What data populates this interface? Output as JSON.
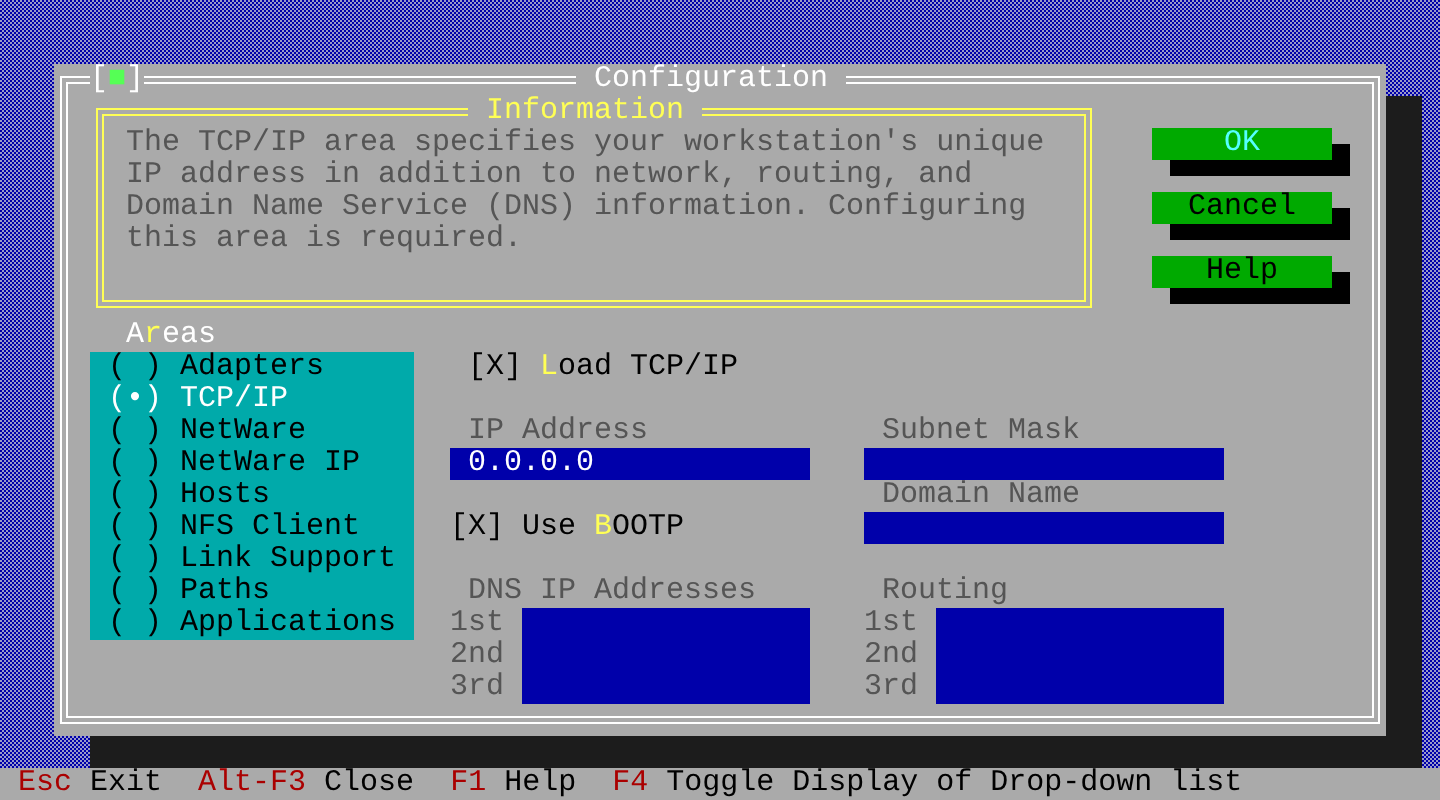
{
  "window": {
    "close_box": "[■]",
    "title": "Configuration"
  },
  "information": {
    "title": "Information",
    "text": "The TCP/IP area specifies your workstation's unique IP address in addition to network, routing, and Domain Name Service (DNS) information. Configuring this area is required."
  },
  "buttons": [
    {
      "label": "OK",
      "focused": true
    },
    {
      "label": "Cancel",
      "focused": false
    },
    {
      "label": "Help",
      "focused": false
    }
  ],
  "areas": {
    "label": {
      "before": "A",
      "key": "r",
      "after": "eas"
    },
    "items": [
      {
        "radio": "( )",
        "label": "Adapters",
        "selected": false
      },
      {
        "radio": "(•)",
        "label": "TCP/IP",
        "selected": true
      },
      {
        "radio": "( )",
        "label": "NetWare",
        "selected": false
      },
      {
        "radio": "( )",
        "label": "NetWare IP",
        "selected": false
      },
      {
        "radio": "( )",
        "label": "Hosts",
        "selected": false
      },
      {
        "radio": "( )",
        "label": "NFS Client",
        "selected": false
      },
      {
        "radio": "( )",
        "label": "Link Support",
        "selected": false
      },
      {
        "radio": "( )",
        "label": "Paths",
        "selected": false
      },
      {
        "radio": "( )",
        "label": "Applications",
        "selected": false
      }
    ]
  },
  "load_tcpip": {
    "box": "[X]",
    "checked": true,
    "key": "L",
    "after": "oad TCP/IP"
  },
  "ip_address": {
    "label": "IP Address",
    "value": "0.0.0.0"
  },
  "subnet_mask": {
    "label": "Subnet Mask"
  },
  "domain_name": {
    "label": "Domain Name"
  },
  "use_bootp": {
    "box": "[X]",
    "checked": true,
    "before": "Use ",
    "key": "B",
    "after": "OOTP"
  },
  "dns_ip_addresses": {
    "label": "DNS IP Addresses",
    "ordinals": [
      "1st",
      "2nd",
      "3rd"
    ]
  },
  "routing": {
    "label": "Routing",
    "ordinals": [
      "1st",
      "2nd",
      "3rd"
    ]
  },
  "status_bar": [
    {
      "key": "Esc",
      "action": "Exit"
    },
    {
      "key": "Alt-F3",
      "action": "Close"
    },
    {
      "key": "F1",
      "action": "Help"
    },
    {
      "key": "F4",
      "action": "Toggle Display of Drop-down list"
    }
  ]
}
